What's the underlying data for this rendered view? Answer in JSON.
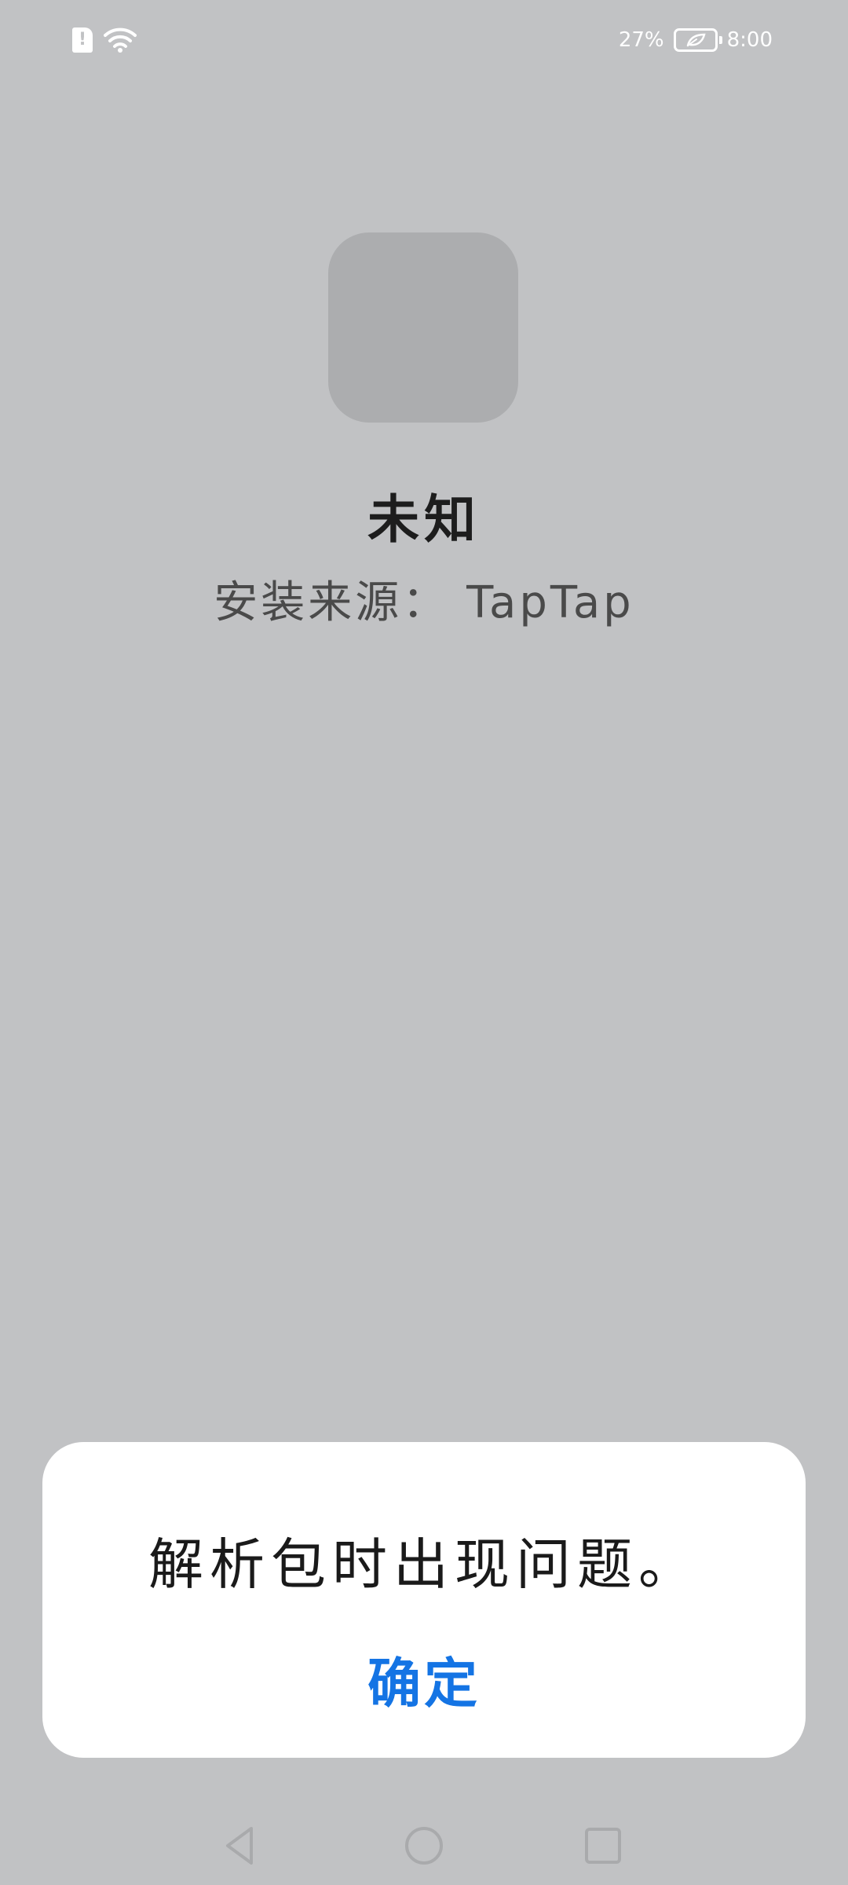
{
  "status_bar": {
    "battery_percent": "27%",
    "time": "8:00",
    "icons": [
      "sim-alert-icon",
      "wifi-icon",
      "battery-icon"
    ]
  },
  "app": {
    "icon": "app-placeholder-icon",
    "name": "未知",
    "install_source": "安装来源： TapTap"
  },
  "dialog": {
    "message": "解析包时出现问题。",
    "confirm_label": "确定",
    "confirm_color": "#1474e4"
  },
  "nav_bar": {
    "icons": [
      "back-icon",
      "home-icon",
      "recent-apps-icon"
    ]
  },
  "colors": {
    "background": "#c1c2c4",
    "dialog_background": "#ffffff"
  }
}
